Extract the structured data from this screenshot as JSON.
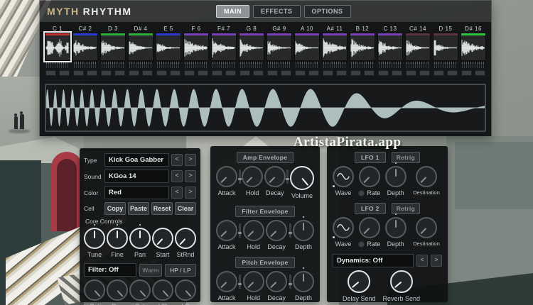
{
  "watermark": "ArtistaPirata.app",
  "header": {
    "logo_myth": "MYTH",
    "logo_rhythm": "RHYTHM",
    "tabs": [
      {
        "label": "MAIN",
        "active": true
      },
      {
        "label": "EFFECTS",
        "active": false
      },
      {
        "label": "OPTIONS",
        "active": false
      }
    ]
  },
  "cells": [
    {
      "label": "C 1",
      "color": "#c23333",
      "selected": true
    },
    {
      "label": "C# 2",
      "color": "#2b3bd0",
      "selected": false
    },
    {
      "label": "D 3",
      "color": "#2fae3e",
      "selected": false
    },
    {
      "label": "D# 4",
      "color": "#2fae3e",
      "selected": false
    },
    {
      "label": "E 5",
      "color": "#2b3bd0",
      "selected": false
    },
    {
      "label": "F 6",
      "color": "#7d3fb5",
      "selected": false
    },
    {
      "label": "F# 7",
      "color": "#7d3fb5",
      "selected": false
    },
    {
      "label": "G 8",
      "color": "#7d3fb5",
      "selected": false
    },
    {
      "label": "G# 9",
      "color": "#7d3fb5",
      "selected": false
    },
    {
      "label": "A 10",
      "color": "#7d3fb5",
      "selected": false
    },
    {
      "label": "A# 11",
      "color": "#7d3fb5",
      "selected": false
    },
    {
      "label": "B 12",
      "color": "#7d3fb5",
      "selected": false
    },
    {
      "label": "C 13",
      "color": "#7d3fb5",
      "selected": false
    },
    {
      "label": "C# 14",
      "color": "#5c3340",
      "selected": false
    },
    {
      "label": "D 15",
      "color": "#5c3340",
      "selected": false
    },
    {
      "label": "D# 16",
      "color": "#2ec43d",
      "selected": false
    }
  ],
  "waveform_display": {
    "description": "pitch-sweep kick waveform",
    "fill": "#adbebe"
  },
  "left_panel": {
    "rows": [
      {
        "label": "Type",
        "value": "Kick Goa Gabber"
      },
      {
        "label": "Sound",
        "value": "KGoa 14"
      },
      {
        "label": "Color",
        "value": "Red"
      }
    ],
    "cell_label": "Cell",
    "cell_buttons": [
      "Copy",
      "Paste",
      "Reset",
      "Clear"
    ],
    "core_title": "Core Controls",
    "core_knobs": [
      "Tune",
      "Fine",
      "Pan",
      "Start",
      "StRnd"
    ],
    "filter_field": "Filter: Off",
    "warm_button": "Warm",
    "hplp_button": "HP / LP",
    "filter_knobs": [
      "Cut",
      "Res",
      "Sat",
      "HP",
      "LP"
    ]
  },
  "envelopes": [
    {
      "title": "Amp Envelope",
      "knobs": [
        "Attack",
        "Hold",
        "Decay",
        "Volume"
      ]
    },
    {
      "title": "Filter Envelope",
      "knobs": [
        "Attack",
        "Hold",
        "Decay",
        "Depth"
      ]
    },
    {
      "title": "Pitch Envelope",
      "knobs": [
        "Attack",
        "Hold",
        "Decay",
        "Depth"
      ]
    }
  ],
  "lfos": [
    {
      "title": "LFO 1",
      "retrig": "Retrig",
      "knobs": [
        "Wave",
        "Rate",
        "Depth",
        "Destination"
      ]
    },
    {
      "title": "LFO 2",
      "retrig": "Retrig",
      "knobs": [
        "Wave",
        "Rate",
        "Depth",
        "Destination"
      ]
    }
  ],
  "dynamics_field": "Dynamics: Off",
  "sends": [
    "Delay Send",
    "Reverb Send"
  ],
  "arrows": {
    "prev": "<",
    "next": ">"
  },
  "colors": {
    "accent_red": "#c23333",
    "accent_blue": "#2b3bd0",
    "accent_green": "#2fae3e",
    "accent_purple": "#7d3fb5",
    "accent_maroon": "#5c3340",
    "wave_fill": "#adbebe"
  }
}
